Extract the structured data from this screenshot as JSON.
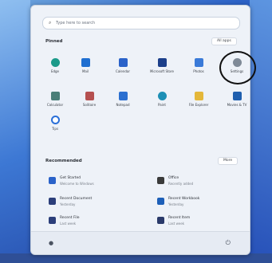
{
  "search": {
    "placeholder": "Type here to search"
  },
  "pinned": {
    "title": "Pinned",
    "all_apps_label": "All apps",
    "apps": [
      {
        "label": "Edge",
        "color": "#1b9a8a",
        "icon": "edge-icon"
      },
      {
        "label": "Mail",
        "color": "#1f6fd1",
        "icon": "mail-icon"
      },
      {
        "label": "Calendar",
        "color": "#2a62c9",
        "icon": "calendar-icon"
      },
      {
        "label": "Microsoft Store",
        "color": "#1c3f8a",
        "icon": "store-icon"
      },
      {
        "label": "Photos",
        "color": "#3a7ad8",
        "icon": "photos-icon"
      },
      {
        "label": "Settings",
        "color": "#7f8a97",
        "icon": "settings-icon"
      },
      {
        "label": "Calculator",
        "color": "#4a7e78",
        "icon": "calculator-icon"
      },
      {
        "label": "Solitaire",
        "color": "#b55050",
        "icon": "solitaire-icon"
      },
      {
        "label": "Notepad",
        "color": "#2b6fd0",
        "icon": "notepad-icon"
      },
      {
        "label": "Paint",
        "color": "#1d8fb5",
        "icon": "paint-icon"
      },
      {
        "label": "File Explorer",
        "color": "#e4b73a",
        "icon": "folder-icon"
      },
      {
        "label": "Movies & TV",
        "color": "#1f5fae",
        "icon": "movies-icon"
      },
      {
        "label": "Tips",
        "color": "#2a6fd8",
        "icon": "tips-icon"
      }
    ]
  },
  "recommended": {
    "title": "Recommended",
    "more_label": "More",
    "items": [
      {
        "title": "Get Started",
        "sub": "Welcome to Windows",
        "color": "#2a62c9",
        "icon": "get-started-icon"
      },
      {
        "title": "Office",
        "sub": "Recently added",
        "color": "#3a3a3a",
        "icon": "office-icon"
      },
      {
        "title": "Recent Document",
        "sub": "Yesterday",
        "color": "#2b3e7a",
        "icon": "document-icon"
      },
      {
        "title": "Recent Workbook",
        "sub": "Yesterday",
        "color": "#1d5fb8",
        "icon": "workbook-icon"
      },
      {
        "title": "Recent File",
        "sub": "Last week",
        "color": "#2b3e7a",
        "icon": "file-icon"
      },
      {
        "title": "Recent Item",
        "sub": "Last week",
        "color": "#2a3a6a",
        "icon": "item-icon"
      }
    ]
  },
  "footer": {
    "user_icon": "user-icon",
    "power_icon": "power-icon"
  }
}
